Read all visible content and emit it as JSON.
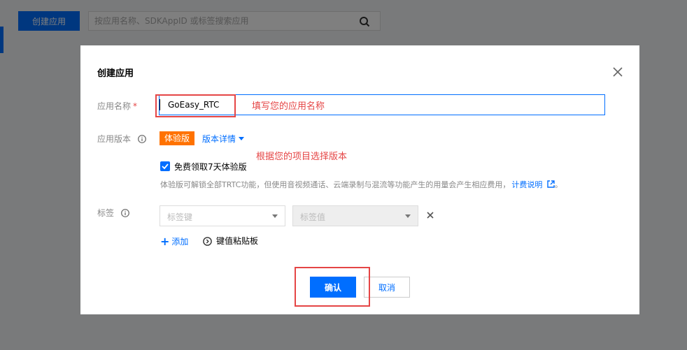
{
  "background": {
    "create_button_label": "创建应用",
    "search_placeholder": "按应用名称、SDKAppID 或标签搜索应用"
  },
  "dialog": {
    "title": "创建应用",
    "app_name": {
      "label": "应用名称",
      "required_mark": "*",
      "value": "GoEasy_RTC",
      "annotation": "填写您的应用名称"
    },
    "app_version": {
      "label": "应用版本",
      "badge": "体验版",
      "details_link": "版本详情",
      "annotation": "根据您的项目选择版本",
      "trial_checkbox_label": "免费领取7天体验版",
      "trial_checked": true,
      "hint": "体验版可解锁全部TRTC功能，但使用音视频通话、云端录制与混流等功能产生的用量会产生相应费用，",
      "billing_link": "计费说明"
    },
    "tags": {
      "label": "标签",
      "key_placeholder": "标签键",
      "value_placeholder": "标签值",
      "add_label": "添加",
      "clipboard_label": "键值粘贴板"
    },
    "confirm_label": "确认",
    "cancel_label": "取消"
  },
  "colors": {
    "primary": "#006eff",
    "trial_badge": "#ff7200",
    "annotation": "#e54545"
  }
}
